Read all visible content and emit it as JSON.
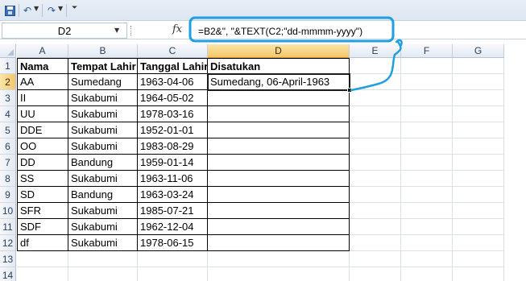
{
  "qat": {
    "save_icon": "save-icon",
    "undo_icon": "undo-icon",
    "redo_icon": "redo-icon",
    "customize_icon": "customize-icon"
  },
  "formula_bar": {
    "name_box": "D2",
    "fx_label": "fx",
    "formula": "=B2&\", \"&TEXT(C2;\"dd-mmmm-yyyy\")"
  },
  "columns": [
    "A",
    "B",
    "C",
    "D",
    "E",
    "F",
    "G"
  ],
  "active_column": "D",
  "active_row": "2",
  "rows": [
    "1",
    "2",
    "3",
    "4",
    "5",
    "6",
    "7",
    "8",
    "9",
    "10",
    "11",
    "12",
    "13",
    "14"
  ],
  "table": {
    "headers": [
      "Nama",
      "Tempat Lahir",
      "Tanggal Lahir",
      "Disatukan"
    ],
    "data": [
      [
        "AA",
        "Sumedang",
        "1963-04-06",
        "Sumedang, 06-April-1963"
      ],
      [
        "II",
        "Sukabumi",
        "1964-05-02",
        ""
      ],
      [
        "UU",
        "Sukabumi",
        "1978-03-16",
        ""
      ],
      [
        "DDE",
        "Sukabumi",
        "1952-01-01",
        ""
      ],
      [
        "OO",
        "Sukabumi",
        "1983-08-29",
        ""
      ],
      [
        "DD",
        "Bandung",
        "1959-01-14",
        ""
      ],
      [
        "SS",
        "Sukabumi",
        "1963-11-06",
        ""
      ],
      [
        "SD",
        "Bandung",
        "1963-03-24",
        ""
      ],
      [
        "SFR",
        "Sukabumi",
        "1985-07-21",
        ""
      ],
      [
        "SDF",
        "Sukabumi",
        "1962-12-04",
        ""
      ],
      [
        "df",
        "Sukabumi",
        "1978-06-15",
        ""
      ]
    ]
  },
  "colors": {
    "annotation": "#1ea0e0",
    "active_header": "#f5c66a"
  }
}
